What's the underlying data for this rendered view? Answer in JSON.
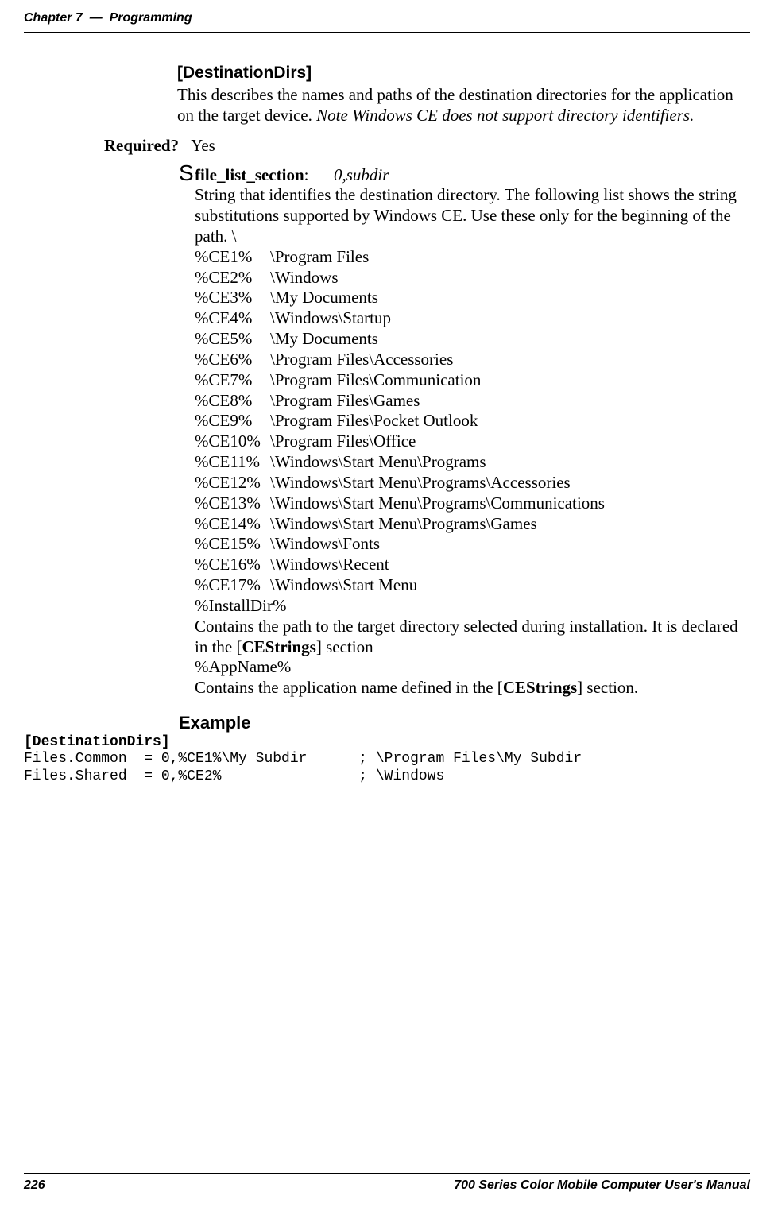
{
  "header": {
    "chapter_label": "Chapter 7",
    "separator": "—",
    "chapter_title": "Programming"
  },
  "section": {
    "title": "[DestinationDirs]",
    "description_1": "This describes the names and paths of the destination directories for the application on the target device. ",
    "description_2_italic": "Note Windows CE does not support directory identifiers."
  },
  "required": {
    "label": "Required?",
    "value": "Yes"
  },
  "bullet": {
    "key": "file_list_section",
    "key_suffix": ":",
    "value_italic": "0,subdir",
    "para1": "String that identifies the destination directory. The following list shows the string substitutions supported by Windows CE. Use these only for the beginning of the path. \\",
    "table": [
      {
        "k": "%CE1%",
        "v": "\\Program Files"
      },
      {
        "k": "%CE2%",
        "v": "\\Windows"
      },
      {
        "k": "%CE3%",
        "v": "\\My Documents"
      },
      {
        "k": "%CE4%",
        "v": "\\Windows\\Startup"
      },
      {
        "k": "%CE5%",
        "v": "\\My Documents"
      },
      {
        "k": "%CE6%",
        "v": "\\Program Files\\Accessories"
      },
      {
        "k": "%CE7%",
        "v": "\\Program Files\\Communication"
      },
      {
        "k": "%CE8%",
        "v": "\\Program Files\\Games"
      },
      {
        "k": "%CE9%",
        "v": "\\Program Files\\Pocket Outlook"
      },
      {
        "k": "%CE10%",
        "v": "\\Program Files\\Office"
      },
      {
        "k": "%CE11%",
        "v": "\\Windows\\Start Menu\\Programs"
      },
      {
        "k": "%CE12%",
        "v": "\\Windows\\Start Menu\\Programs\\Accessories"
      },
      {
        "k": "%CE13%",
        "v": "\\Windows\\Start Menu\\Programs\\Communications"
      },
      {
        "k": "%CE14%",
        "v": "\\Windows\\Start Menu\\Programs\\Games"
      },
      {
        "k": "%CE15%",
        "v": "\\Windows\\Fonts"
      },
      {
        "k": "%CE16%",
        "v": "\\Windows\\Recent"
      },
      {
        "k": "%CE17%",
        "v": "\\Windows\\Start Menu"
      }
    ],
    "installdir_label": "%InstallDir%",
    "installdir_text_a": "Contains the path to the target directory selected during installation. It is declared in the [",
    "installdir_text_b": "CEStrings",
    "installdir_text_c": "] section",
    "appname_label": "%AppName%",
    "appname_text_a": "Contains the application name defined in the [",
    "appname_text_b": "CEStrings",
    "appname_text_c": "] section."
  },
  "example": {
    "title": "Example",
    "line1": "[DestinationDirs]",
    "line2": "Files.Common  = 0,%CE1%\\My Subdir      ; \\Program Files\\My Subdir",
    "line3": "Files.Shared  = 0,%CE2%                ; \\Windows"
  },
  "footer": {
    "page_number": "226",
    "manual_title": "700 Series Color Mobile Computer User's Manual"
  }
}
